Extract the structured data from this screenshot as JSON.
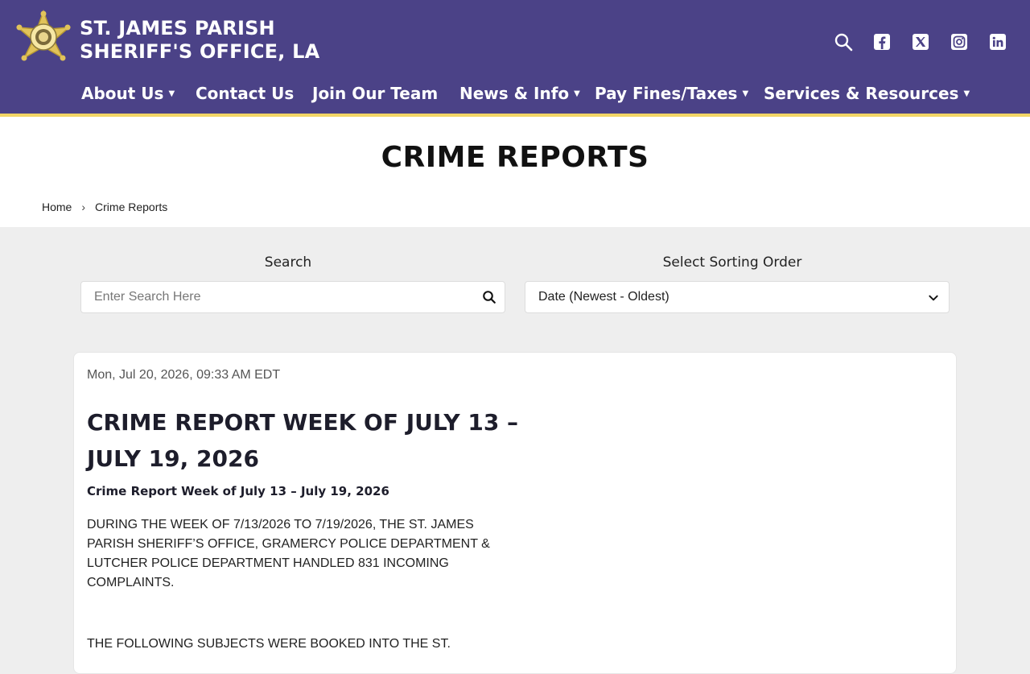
{
  "header": {
    "site_name_line1": "ST. JAMES PARISH",
    "site_name_line2": "SHERIFF'S OFFICE, LA",
    "icons": [
      "search-icon",
      "facebook-icon",
      "x-twitter-icon",
      "instagram-icon",
      "linkedin-icon"
    ],
    "colors": {
      "bar": "#4b4287",
      "accent": "#f2d566"
    }
  },
  "nav": {
    "items": [
      {
        "label": "About Us",
        "has_dropdown": true
      },
      {
        "label": "Contact Us",
        "has_dropdown": false
      },
      {
        "label": "Join Our Team",
        "has_dropdown": false
      },
      {
        "label": "News & Info",
        "has_dropdown": true
      },
      {
        "label": "Pay Fines/Taxes",
        "has_dropdown": true
      },
      {
        "label": "Services & Resources",
        "has_dropdown": true
      }
    ]
  },
  "page": {
    "title": "CRIME REPORTS",
    "breadcrumb": {
      "home": "Home",
      "separator": "›",
      "current": "Crime Reports"
    }
  },
  "filters": {
    "search_label": "Search",
    "search_placeholder": "Enter Search Here",
    "sort_label": "Select Sorting Order",
    "sort_selected": "Date (Newest - Oldest)"
  },
  "report": {
    "date": "Mon, Jul 20, 2026, 09:33 AM EDT",
    "title": "CRIME REPORT WEEK OF JULY 13 – JULY 19, 2026",
    "subtitle": "Crime Report Week of July 13 – July 19, 2026",
    "body": "DURING THE WEEK OF 7/13/2026 TO 7/19/2026, THE ST. JAMES PARISH SHERIFF’S OFFICE, GRAMERCY POLICE DEPARTMENT & LUTCHER POLICE DEPARTMENT HANDLED 831 INCOMING COMPLAINTS.",
    "body_continued": "THE FOLLOWING SUBJECTS WERE BOOKED INTO THE ST."
  }
}
